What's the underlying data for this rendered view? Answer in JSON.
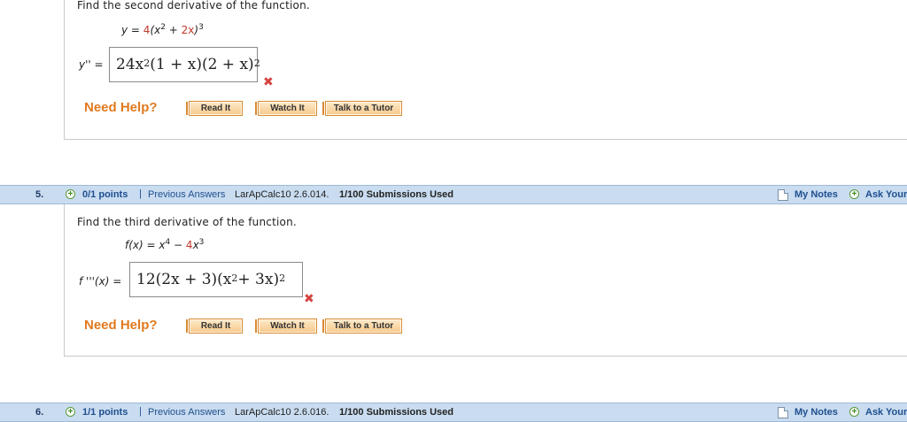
{
  "q4": {
    "prompt": "Find the second derivative of the function.",
    "given": {
      "y": "y",
      "eq": " = ",
      "a": "4",
      "b": "(x",
      "e1": "2",
      "c": " + ",
      "d": "2x",
      "f": ")",
      "e2": "3"
    },
    "lhs": "y'' =",
    "answer": {
      "a": "24x",
      "e1": "2",
      "b": "(1 + x)(2 + x)",
      "e2": "2"
    },
    "status": "incorrect"
  },
  "q5": {
    "number": "5.",
    "points": "0/1 points",
    "sep": "|",
    "previous": "Previous Answers",
    "code": "LarApCalc10 2.6.014.",
    "submissions": "1/100 Submissions Used",
    "prompt": "Find the third derivative of the function.",
    "given": {
      "f": "f(x)",
      "eq": " = ",
      "a": "x",
      "e1": "4",
      "m": " − ",
      "b": "4",
      "c": "x",
      "e2": "3"
    },
    "lhs": "f '''(x) =",
    "answer": {
      "a": "12(2x + 3)(x",
      "e1": "2",
      "b": " + 3x)",
      "e2": "2"
    },
    "status": "incorrect"
  },
  "q6": {
    "number": "6.",
    "points": "1/1 points",
    "sep": "|",
    "previous": "Previous Answers",
    "code": "LarApCalc10 2.6.016.",
    "submissions": "1/100 Submissions Used"
  },
  "help": {
    "label": "Need Help?",
    "read": "Read It",
    "watch": "Watch It",
    "tutor": "Talk to a Tutor"
  },
  "toolbar": {
    "my_notes": "My Notes",
    "ask": "Ask Your"
  },
  "icons": {
    "plus": "+",
    "x": "✖"
  },
  "colors": {
    "header_bg": "#c9dcf0",
    "need_help": "#e07a1f",
    "error": "#d64541",
    "link": "#1f4f8f"
  }
}
